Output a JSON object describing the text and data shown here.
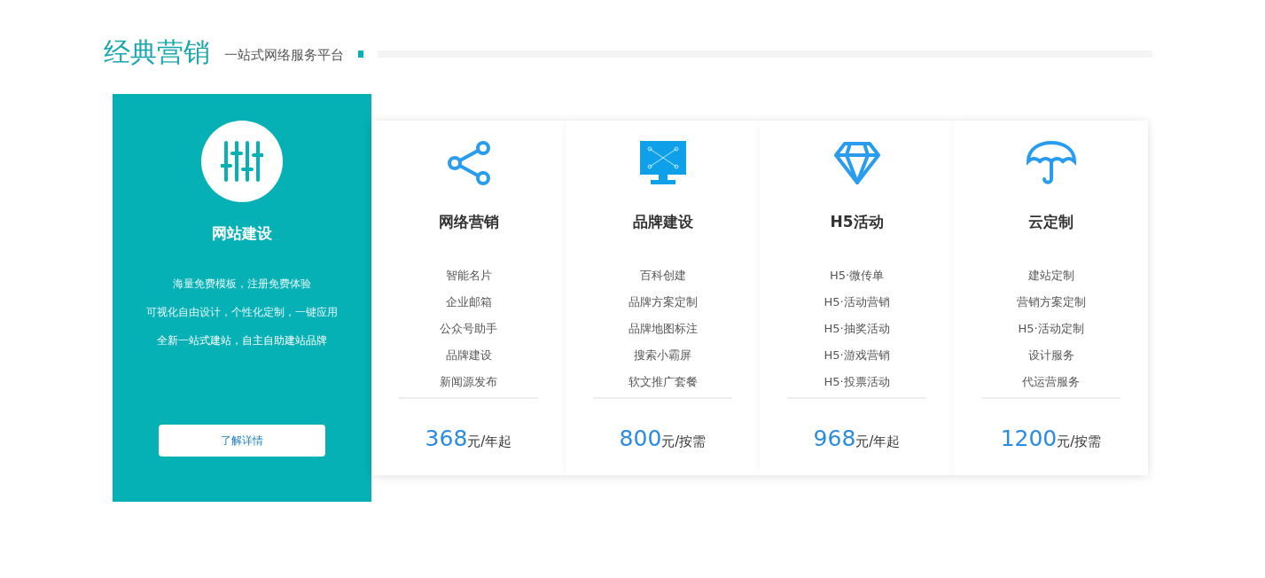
{
  "header": {
    "title": "经典营销",
    "subtitle": "一站式网络服务平台"
  },
  "feature": {
    "title": "网站建设",
    "lines": [
      "海量免费模板，注册免费体验",
      "可视化自由设计，个性化定制，一键应用",
      "全新一站式建站，自主自助建站品牌"
    ],
    "button": "了解详情"
  },
  "plans": [
    {
      "kind": "share",
      "title": "网络营销",
      "items": [
        "智能名片",
        "企业邮箱",
        "公众号助手",
        "品牌建设",
        "新闻源发布"
      ],
      "price": "368",
      "unit": "元/年起"
    },
    {
      "kind": "monitor",
      "title": "品牌建设",
      "items": [
        "百科创建",
        "品牌方案定制",
        "品牌地图标注",
        "搜索小霸屏",
        "软文推广套餐"
      ],
      "price": "800",
      "unit": "元/按需"
    },
    {
      "kind": "diamond",
      "title": "H5活动",
      "items": [
        "H5·微传单",
        "H5·活动营销",
        "H5·抽奖活动",
        "H5·游戏营销",
        "H5·投票活动"
      ],
      "price": "968",
      "unit": "元/年起"
    },
    {
      "kind": "umbrella",
      "title": "云定制",
      "items": [
        "建站定制",
        "营销方案定制",
        "H5·活动定制",
        "设计服务",
        "代运营服务"
      ],
      "price": "1200",
      "unit": "元/按需"
    }
  ]
}
